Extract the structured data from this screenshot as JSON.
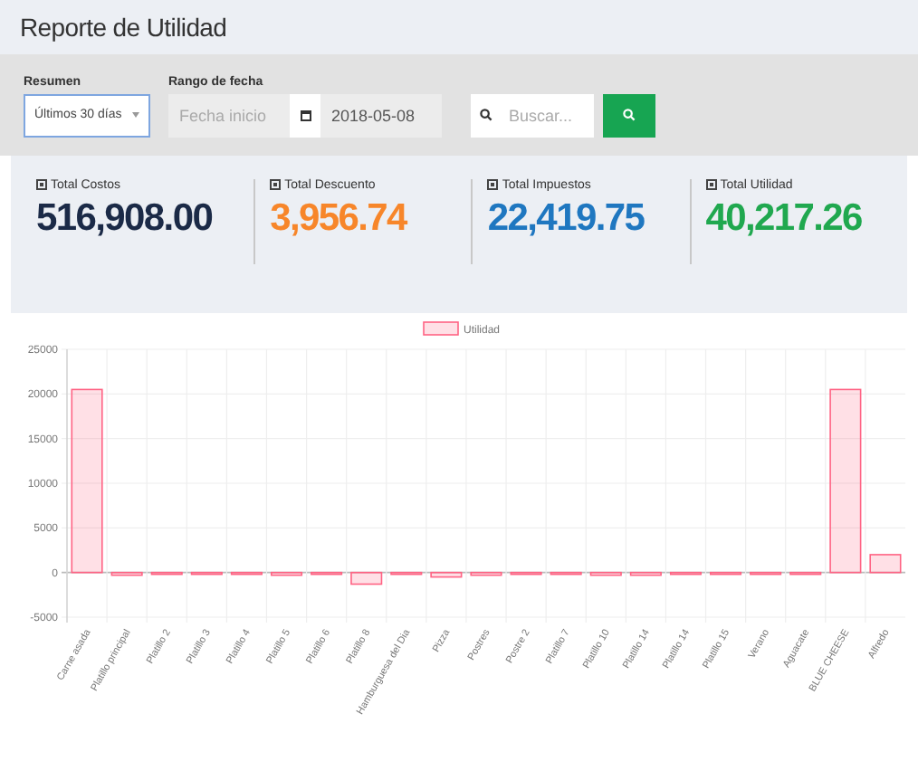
{
  "page": {
    "title": "Reporte de Utilidad"
  },
  "filters": {
    "summary": {
      "label": "Resumen",
      "value": "Últimos 30 días"
    },
    "date_range": {
      "label": "Rango de fecha",
      "start": {
        "placeholder": "Fecha inicio"
      },
      "end": {
        "value": "2018-05-08"
      }
    },
    "search": {
      "placeholder": "Buscar..."
    }
  },
  "stats": [
    {
      "label": "Total Costos",
      "value": "516,908.00",
      "color": "#1b2a47"
    },
    {
      "label": "Total Descuento",
      "value": "3,956.74",
      "color": "#f7862a"
    },
    {
      "label": "Total Impuestos",
      "value": "22,419.75",
      "color": "#1f77c0"
    },
    {
      "label": "Total Utilidad",
      "value": "40,217.26",
      "color": "#20a84f"
    }
  ],
  "chart": {
    "chart_data": {
      "type": "bar",
      "categories": [
        "Carne asada",
        "Platillo principal",
        "Platillo 2",
        "Platillo 3",
        "Platillo 4",
        "Platillo 5",
        "Platillo 6",
        "Platillo 8",
        "Hamburguesa del Dia",
        "Pizza",
        "Postres",
        "Postre 2",
        "Platillo 7",
        "Platillo 10",
        "Platillo 14",
        "Platillo 14",
        "Platillo 15",
        "Verano",
        "Aguacate",
        "BLUE CHEESE",
        "Alfredo"
      ],
      "series": [
        {
          "name": "Utilidad",
          "color": "#ff6384",
          "values": [
            20500,
            -300,
            -100,
            -100,
            -100,
            -300,
            -100,
            -1300,
            -100,
            -500,
            -300,
            -100,
            -100,
            -300,
            -300,
            -100,
            -100,
            -100,
            -100,
            20500,
            2000
          ]
        }
      ],
      "ylim": [
        -5000,
        25000
      ],
      "grid": true,
      "yticks": [
        25000,
        20000,
        15000,
        10000,
        5000,
        0,
        -5000
      ]
    }
  }
}
